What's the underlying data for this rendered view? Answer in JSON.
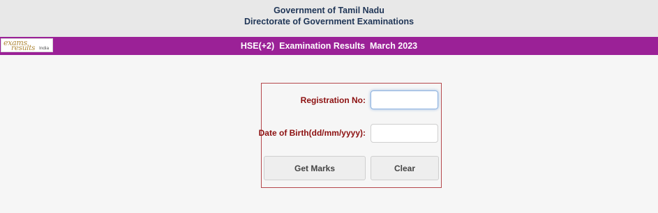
{
  "header": {
    "line1": "Government of Tamil Nadu",
    "line2": "Directorate of Government Examinations"
  },
  "banner": {
    "title": "HSE(+2)  Examination Results  March 2023",
    "color": "#9b2197"
  },
  "logo": {
    "line1": "exams",
    "line2": "results",
    "line3": "India"
  },
  "form": {
    "registration_label": "Registration No:",
    "registration_value": "",
    "dob_label": "Date of Birth(dd/mm/yyyy):",
    "dob_value": "",
    "get_marks_label": "Get Marks",
    "clear_label": "Clear",
    "label_color": "#8c1010",
    "border_color": "#b5474b"
  }
}
